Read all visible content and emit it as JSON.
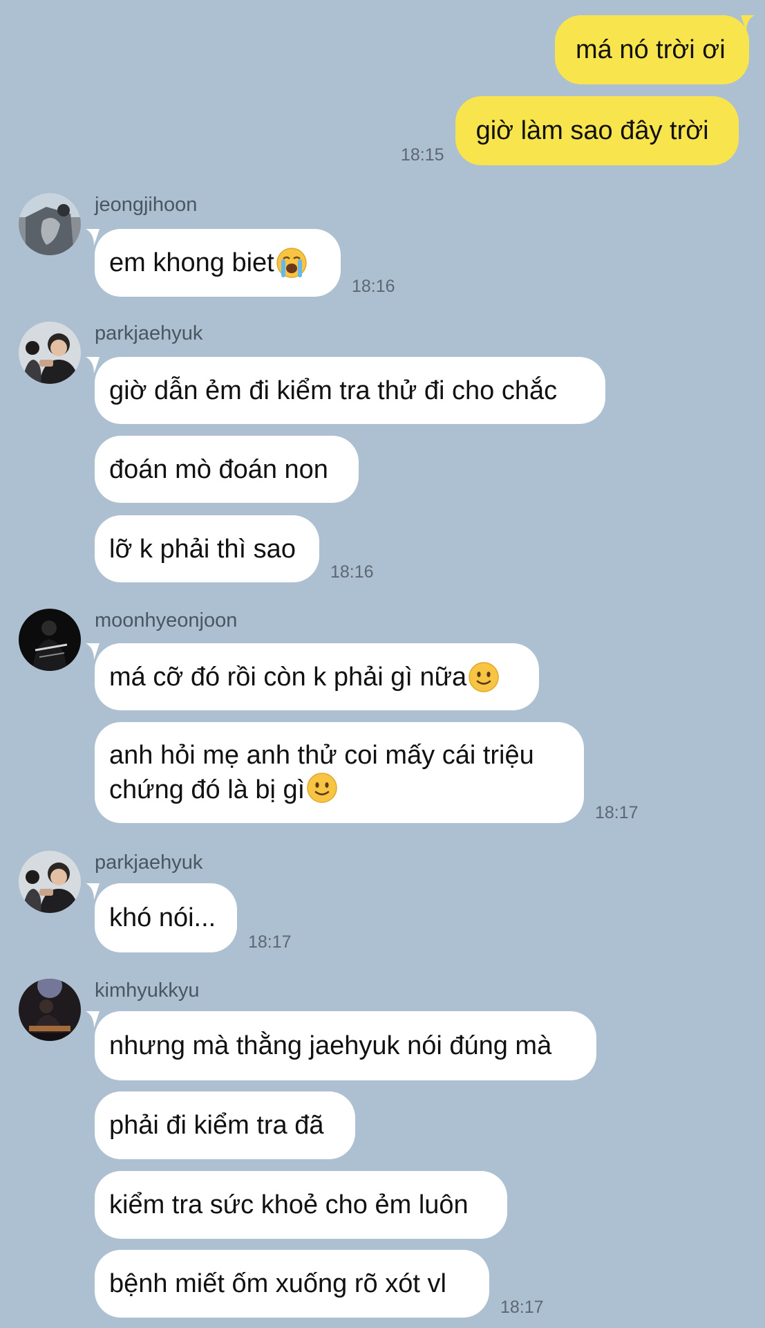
{
  "colors": {
    "background": "#adc0d1",
    "outgoing_bubble": "#f8e44c",
    "incoming_bubble": "#ffffff",
    "timestamp": "#5c6773"
  },
  "outgoing": {
    "messages": [
      "má nó trời ơi",
      "giờ làm sao đây trời"
    ],
    "time": "18:15"
  },
  "groups": [
    {
      "sender": "jeongjihoon",
      "avatar_icon": "photo-avatar-icon",
      "messages": [
        "em khong biet"
      ],
      "emoji": "loudly-crying-face-icon",
      "time": "18:16"
    },
    {
      "sender": "parkjaehyuk",
      "avatar_icon": "photo-avatar-icon",
      "messages": [
        "giờ dẫn ẻm đi kiểm tra thử đi cho chắc",
        "đoán mò đoán non",
        "lỡ k phải thì sao"
      ],
      "time": "18:16"
    },
    {
      "sender": "moonhyeonjoon",
      "avatar_icon": "photo-avatar-icon",
      "messages": [
        "má cỡ đó rồi còn k phải gì nữa",
        "anh hỏi mẹ anh thử coi mấy cái triệu chứng đó là bị gì"
      ],
      "emoji": "slightly-smiling-face-icon",
      "time": "18:17"
    },
    {
      "sender": "parkjaehyuk",
      "avatar_icon": "photo-avatar-icon",
      "messages": [
        "khó nói..."
      ],
      "time": "18:17"
    },
    {
      "sender": "kimhyukkyu",
      "avatar_icon": "photo-avatar-icon",
      "messages": [
        "nhưng mà thằng jaehyuk nói đúng mà",
        "phải đi kiểm tra đã",
        "kiểm tra sức khoẻ cho ẻm luôn",
        "bệnh miết ốm xuống rõ xót vl"
      ],
      "time": "18:17"
    }
  ]
}
